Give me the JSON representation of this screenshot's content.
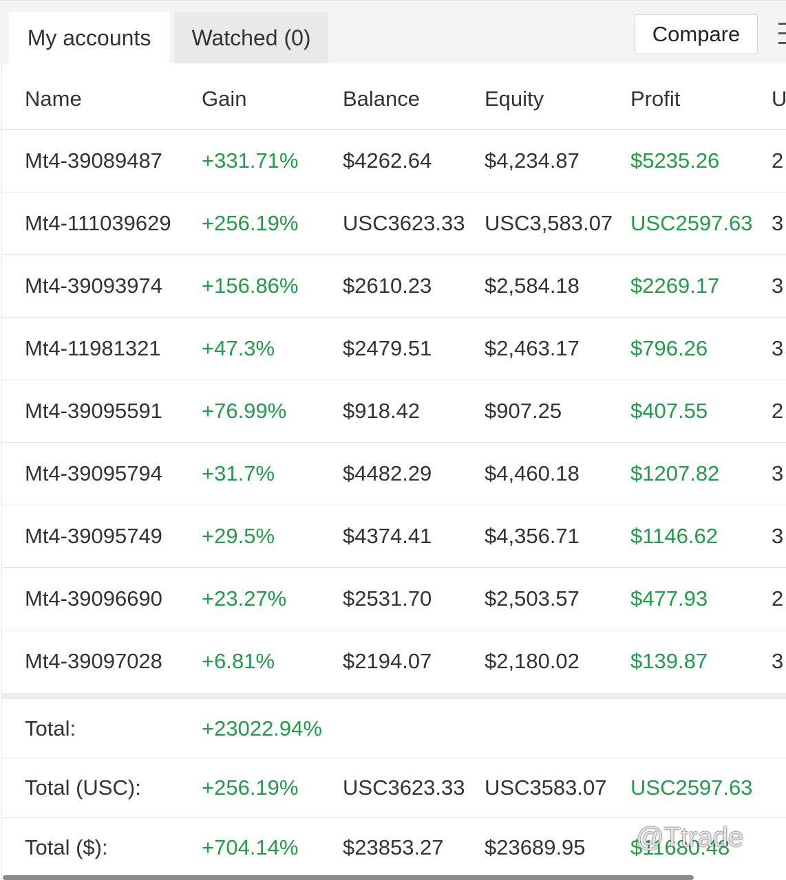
{
  "tabs": {
    "my_accounts": "My accounts",
    "watched": "Watched (0)"
  },
  "toolbar": {
    "compare_label": "Compare"
  },
  "table": {
    "headers": [
      "Name",
      "Gain",
      "Balance",
      "Equity",
      "Profit",
      "U"
    ],
    "rows": [
      {
        "name": "Mt4-39089487",
        "gain": "+331.71%",
        "balance": "$4262.64",
        "equity": "$4,234.87",
        "profit": "$5235.26",
        "u": "2"
      },
      {
        "name": "Mt4-111039629",
        "gain": "+256.19%",
        "balance": "USC3623.33",
        "equity": "USC3,583.07",
        "profit": "USC2597.63",
        "u": "3"
      },
      {
        "name": "Mt4-39093974",
        "gain": "+156.86%",
        "balance": "$2610.23",
        "equity": "$2,584.18",
        "profit": "$2269.17",
        "u": "3"
      },
      {
        "name": "Mt4-11981321",
        "gain": "+47.3%",
        "balance": "$2479.51",
        "equity": "$2,463.17",
        "profit": "$796.26",
        "u": "3"
      },
      {
        "name": "Mt4-39095591",
        "gain": "+76.99%",
        "balance": "$918.42",
        "equity": "$907.25",
        "profit": "$407.55",
        "u": "2"
      },
      {
        "name": "Mt4-39095794",
        "gain": "+31.7%",
        "balance": "$4482.29",
        "equity": "$4,460.18",
        "profit": "$1207.82",
        "u": "3"
      },
      {
        "name": "Mt4-39095749",
        "gain": "+29.5%",
        "balance": "$4374.41",
        "equity": "$4,356.71",
        "profit": "$1146.62",
        "u": "3"
      },
      {
        "name": "Mt4-39096690",
        "gain": "+23.27%",
        "balance": "$2531.70",
        "equity": "$2,503.57",
        "profit": "$477.93",
        "u": "2"
      },
      {
        "name": "Mt4-39097028",
        "gain": "+6.81%",
        "balance": "$2194.07",
        "equity": "$2,180.02",
        "profit": "$139.87",
        "u": "3"
      }
    ]
  },
  "totals": [
    {
      "label": "Total:",
      "gain": "+23022.94%",
      "balance": "",
      "equity": "",
      "profit": ""
    },
    {
      "label": "Total (USC):",
      "gain": "+256.19%",
      "balance": "USC3623.33",
      "equity": "USC3583.07",
      "profit": "USC2597.63"
    },
    {
      "label": "Total ($):",
      "gain": "+704.14%",
      "balance": "$23853.27",
      "equity": "$23689.95",
      "profit": "$11680.48"
    }
  ],
  "watermark": "@Ttrade",
  "colors": {
    "positive": "#1e9e45",
    "text": "#333333"
  }
}
